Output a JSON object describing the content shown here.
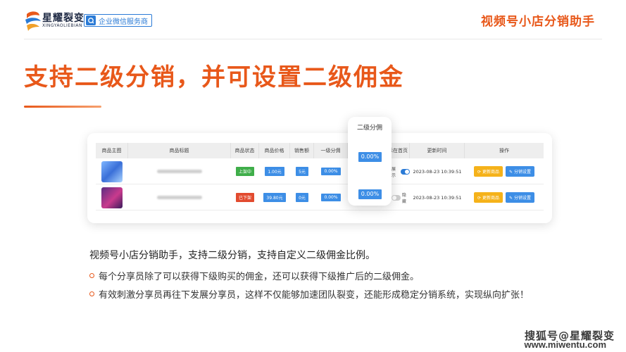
{
  "header": {
    "brand_name": "星耀裂变",
    "brand_sub": "XINGYAOLIEBIAN",
    "partner_label": "企业微信服务商",
    "top_title": "视频号小店分销助手"
  },
  "main_title": "支持二级分销，并可设置二级佣金",
  "table": {
    "columns": [
      "商品主图",
      "商品标题",
      "商品状态",
      "商品价格",
      "销售额",
      "一级分佣",
      "二级分佣",
      "是否展示在首页",
      "更新时间",
      "操作"
    ],
    "rows": [
      {
        "status": "上架中",
        "price": "1.00元",
        "sales": "5元",
        "level1": "0.00%",
        "show_label": "展示",
        "updated": "2023-08-23 10:39:51",
        "action_update": "更新商品",
        "action_settings": "分销设置"
      },
      {
        "status": "已下架",
        "price": "39.80元",
        "sales": "0元",
        "level1": "0.00%",
        "show_label": "隐藏",
        "updated": "2023-08-23 10:39:51",
        "action_update": "更新商品",
        "action_settings": "分销设置"
      }
    ]
  },
  "popup": {
    "header": "二级分佣",
    "values": [
      "0.00%",
      "0.00%"
    ]
  },
  "description": "视频号小店分销助手，支持二级分销，支持自定义二级佣金比例。",
  "bullets": [
    "每个分享员除了可以获得下级购买的佣金，还可以获得下级推广后的二级佣金。",
    "有效刺激分享员再往下发展分享员，这样不仅能够加速团队裂变，还能形成稳定分销系统，实现纵向扩张！"
  ],
  "watermark": "搜狐号@星耀裂变",
  "watermark_url": "www.miwentu.com",
  "colors": {
    "accent": "#e8581a",
    "blue": "#3d8ee6",
    "green": "#3fae4a",
    "red": "#e24b2f",
    "yellow": "#f5b21a"
  }
}
